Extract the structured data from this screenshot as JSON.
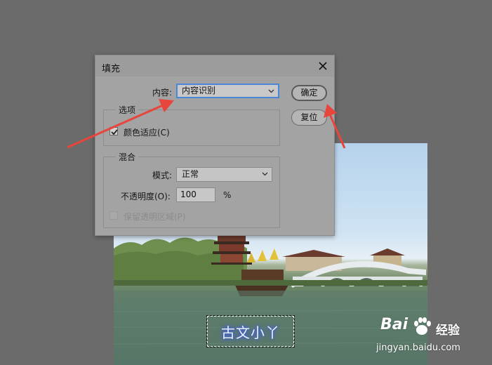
{
  "dialog": {
    "title": "填充",
    "content_label": "内容:",
    "content_value": "内容识别",
    "ok_label": "确定",
    "reset_label": "复位",
    "options_legend": "选项",
    "color_adapt_label": "颜色适应(C)",
    "color_adapt_checked": true,
    "blend_legend": "混合",
    "mode_label": "模式:",
    "mode_value": "正常",
    "opacity_label": "不透明度(O):",
    "opacity_value": "100",
    "opacity_unit": "%",
    "preserve_label": "保留透明区域(P)",
    "preserve_checked": false,
    "preserve_enabled": false
  },
  "canvas": {
    "selection_text": "古文小丫"
  },
  "watermark": {
    "brand": "Bai",
    "suffix": "经验",
    "url": "jingyan.baidu.com"
  },
  "colors": {
    "workspace": "#6b6b6b",
    "dialog": "#a3a3a3",
    "focus_border": "#4a87d6",
    "annotation_arrow": "#e8453c"
  },
  "icons": [
    "close-icon",
    "chevron-down-icon",
    "checkmark-icon",
    "red-arrow-annotation"
  ]
}
